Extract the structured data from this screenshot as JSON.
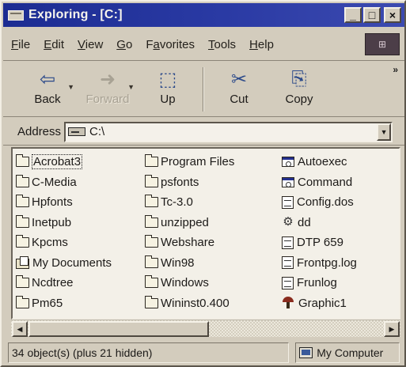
{
  "window": {
    "title": "Exploring - [C:]"
  },
  "title_buttons": {
    "minimize": "_",
    "maximize": "□",
    "close": "×"
  },
  "menu": [
    {
      "label": "File",
      "key": "F",
      "rest": "ile"
    },
    {
      "label": "Edit",
      "key": "E",
      "rest": "dit"
    },
    {
      "label": "View",
      "key": "V",
      "rest": "iew"
    },
    {
      "label": "Go",
      "key": "G",
      "rest": "o"
    },
    {
      "label": "Favorites",
      "pre": "F",
      "key": "a",
      "rest": "vorites"
    },
    {
      "label": "Tools",
      "key": "T",
      "rest": "ools"
    },
    {
      "label": "Help",
      "key": "H",
      "rest": "elp"
    }
  ],
  "toolbar": {
    "back": {
      "label": "Back",
      "icon": "⇦"
    },
    "forward": {
      "label": "Forward",
      "icon": "➜"
    },
    "up": {
      "label": "Up",
      "icon": "⬚"
    },
    "cut": {
      "label": "Cut",
      "icon": "✂"
    },
    "copy": {
      "label": "Copy",
      "icon": "⎘"
    },
    "more": "»"
  },
  "address": {
    "label": "Address",
    "value": "C:\\"
  },
  "files": {
    "col1": [
      {
        "name": "Acrobat3",
        "icon": "folder-icon"
      },
      {
        "name": "C-Media",
        "icon": "folder-icon"
      },
      {
        "name": "Hpfonts",
        "icon": "folder-icon"
      },
      {
        "name": "Inetpub",
        "icon": "folder-icon"
      },
      {
        "name": "Kpcms",
        "icon": "folder-icon"
      },
      {
        "name": "My Documents",
        "icon": "my-documents-icon"
      },
      {
        "name": "Ncdtree",
        "icon": "folder-icon"
      },
      {
        "name": "Pm65",
        "icon": "folder-icon"
      }
    ],
    "col2": [
      {
        "name": "Program Files",
        "icon": "folder-icon"
      },
      {
        "name": "psfonts",
        "icon": "folder-icon"
      },
      {
        "name": "Tc-3.0",
        "icon": "folder-icon"
      },
      {
        "name": "unzipped",
        "icon": "folder-icon"
      },
      {
        "name": "Webshare",
        "icon": "folder-icon"
      },
      {
        "name": "Win98",
        "icon": "folder-icon"
      },
      {
        "name": "Windows",
        "icon": "folder-icon"
      },
      {
        "name": "Wininst0.400",
        "icon": "folder-icon"
      }
    ],
    "col3": [
      {
        "name": "Autoexec",
        "icon": "batch-file-icon"
      },
      {
        "name": "Command",
        "icon": "ms-dos-program-icon"
      },
      {
        "name": "Config.dos",
        "icon": "document-icon"
      },
      {
        "name": "dd",
        "icon": "settings-file-icon"
      },
      {
        "name": "DTP 659",
        "icon": "word-document-icon"
      },
      {
        "name": "Frontpg.log",
        "icon": "document-icon"
      },
      {
        "name": "Frunlog",
        "icon": "text-file-icon"
      },
      {
        "name": "Graphic1",
        "icon": "graphic-file-icon"
      }
    ]
  },
  "status": {
    "objects": "34 object(s) (plus 21 hidden)",
    "location": "My Computer"
  }
}
